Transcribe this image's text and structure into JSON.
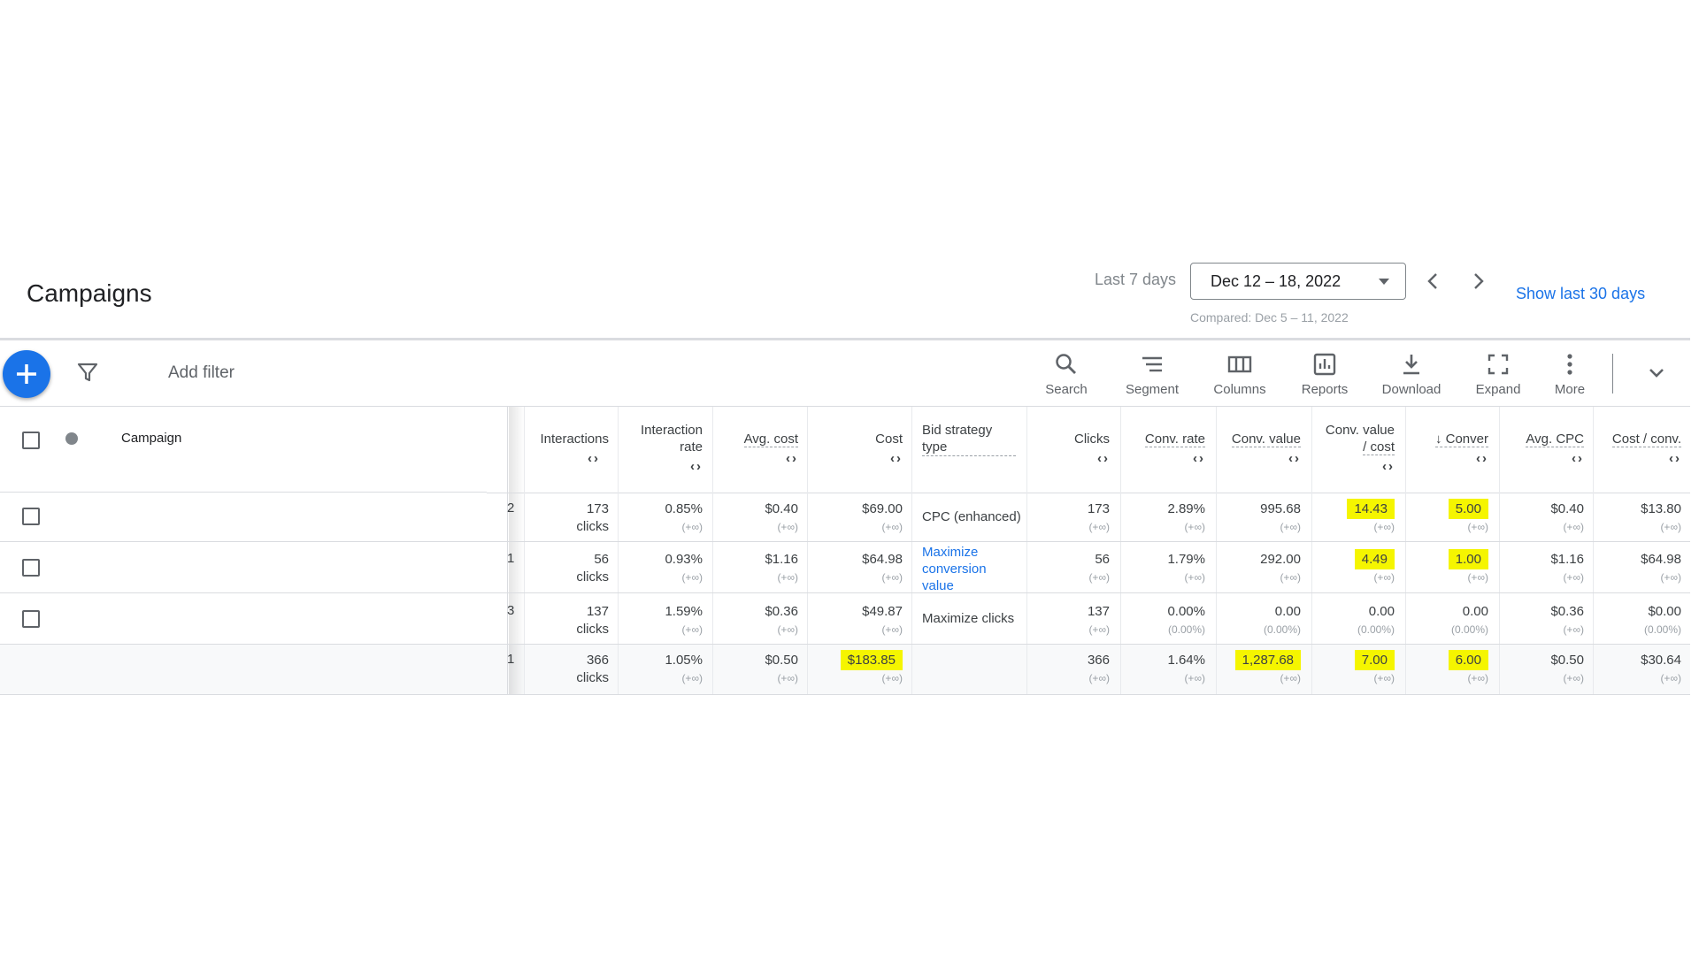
{
  "header": {
    "title": "Campaigns",
    "date_range_label": "Last 7 days",
    "date_range": "Dec 12 – 18, 2022",
    "compared": "Compared: Dec 5 – 11, 2022",
    "show_last_30": "Show last 30 days"
  },
  "toolbar": {
    "add_filter": "Add filter",
    "tools": [
      {
        "label": "Search",
        "icon": "search-icon"
      },
      {
        "label": "Segment",
        "icon": "segment-icon"
      },
      {
        "label": "Columns",
        "icon": "columns-icon"
      },
      {
        "label": "Reports",
        "icon": "reports-icon"
      },
      {
        "label": "Download",
        "icon": "download-icon"
      },
      {
        "label": "Expand",
        "icon": "expand-icon"
      },
      {
        "label": "More",
        "icon": "more-vert-icon"
      }
    ]
  },
  "table": {
    "campaign_header": "Campaign",
    "sort_glyph": "‹›",
    "headers": {
      "interactions": "Interactions",
      "interaction_rate_1": "Interaction",
      "interaction_rate_2": "rate",
      "avg_cost": "Avg. cost",
      "cost": "Cost",
      "bid_1": "Bid strategy",
      "bid_2": "type",
      "clicks": "Clicks",
      "conv_rate": "Conv. rate",
      "conv_value": "Conv. value",
      "conv_value_cost_1": "Conv. value",
      "conv_value_cost_2": "/ cost",
      "conversions": "↓ Conver",
      "avg_cpc": "Avg. CPC",
      "cost_per_conv": "Cost / conv."
    },
    "edge_fragments": [
      "2",
      "1",
      "3",
      "1"
    ],
    "rows": [
      {
        "interactions": "173",
        "interactions_unit": "clicks",
        "interaction_rate": "0.85%",
        "interaction_rate_sub": "(+∞)",
        "avg_cost": "$0.40",
        "avg_cost_sub": "(+∞)",
        "cost": "$69.00",
        "cost_sub": "(+∞)",
        "bid_1": "CPC (enhanced)",
        "bid_2": "",
        "bid_3": "",
        "clicks": "173",
        "clicks_sub": "(+∞)",
        "conv_rate": "2.89%",
        "conv_rate_sub": "(+∞)",
        "conv_value": "995.68",
        "conv_value_sub": "(+∞)",
        "conv_value_cost": "14.43",
        "conv_value_cost_sub": "(+∞)",
        "conversions": "5.00",
        "conversions_sub": "(+∞)",
        "avg_cpc": "$0.40",
        "avg_cpc_sub": "(+∞)",
        "cost_per_conv": "$13.80",
        "cost_per_conv_sub": "(+∞)"
      },
      {
        "interactions": "56",
        "interactions_unit": "clicks",
        "interaction_rate": "0.93%",
        "interaction_rate_sub": "(+∞)",
        "avg_cost": "$1.16",
        "avg_cost_sub": "(+∞)",
        "cost": "$64.98",
        "cost_sub": "(+∞)",
        "bid_1": "Maximize",
        "bid_2": "conversion",
        "bid_3": "value",
        "clicks": "56",
        "clicks_sub": "(+∞)",
        "conv_rate": "1.79%",
        "conv_rate_sub": "(+∞)",
        "conv_value": "292.00",
        "conv_value_sub": "(+∞)",
        "conv_value_cost": "4.49",
        "conv_value_cost_sub": "(+∞)",
        "conversions": "1.00",
        "conversions_sub": "(+∞)",
        "avg_cpc": "$1.16",
        "avg_cpc_sub": "(+∞)",
        "cost_per_conv": "$64.98",
        "cost_per_conv_sub": "(+∞)"
      },
      {
        "interactions": "137",
        "interactions_unit": "clicks",
        "interaction_rate": "1.59%",
        "interaction_rate_sub": "(+∞)",
        "avg_cost": "$0.36",
        "avg_cost_sub": "(+∞)",
        "cost": "$49.87",
        "cost_sub": "(+∞)",
        "bid_1": "Maximize clicks",
        "bid_2": "",
        "bid_3": "",
        "clicks": "137",
        "clicks_sub": "(+∞)",
        "conv_rate": "0.00%",
        "conv_rate_sub": "(0.00%)",
        "conv_value": "0.00",
        "conv_value_sub": "(0.00%)",
        "conv_value_cost": "0.00",
        "conv_value_cost_sub": "(0.00%)",
        "conversions": "0.00",
        "conversions_sub": "(0.00%)",
        "avg_cpc": "$0.36",
        "avg_cpc_sub": "(+∞)",
        "cost_per_conv": "$0.00",
        "cost_per_conv_sub": "(0.00%)"
      },
      {
        "interactions": "366",
        "interactions_unit": "clicks",
        "interaction_rate": "1.05%",
        "interaction_rate_sub": "(+∞)",
        "avg_cost": "$0.50",
        "avg_cost_sub": "(+∞)",
        "cost": "$183.85",
        "cost_sub": "(+∞)",
        "bid_1": "",
        "bid_2": "",
        "bid_3": "",
        "clicks": "366",
        "clicks_sub": "(+∞)",
        "conv_rate": "1.64%",
        "conv_rate_sub": "(+∞)",
        "conv_value": "1,287.68",
        "conv_value_sub": "(+∞)",
        "conv_value_cost": "7.00",
        "conv_value_cost_sub": "(+∞)",
        "conversions": "6.00",
        "conversions_sub": "(+∞)",
        "avg_cpc": "$0.50",
        "avg_cpc_sub": "(+∞)",
        "cost_per_conv": "$30.64",
        "cost_per_conv_sub": "(+∞)"
      }
    ]
  },
  "colors": {
    "primary": "#1a73e8",
    "highlight": "#f5f500",
    "text": "#3c4043",
    "muted": "#9aa0a6"
  }
}
